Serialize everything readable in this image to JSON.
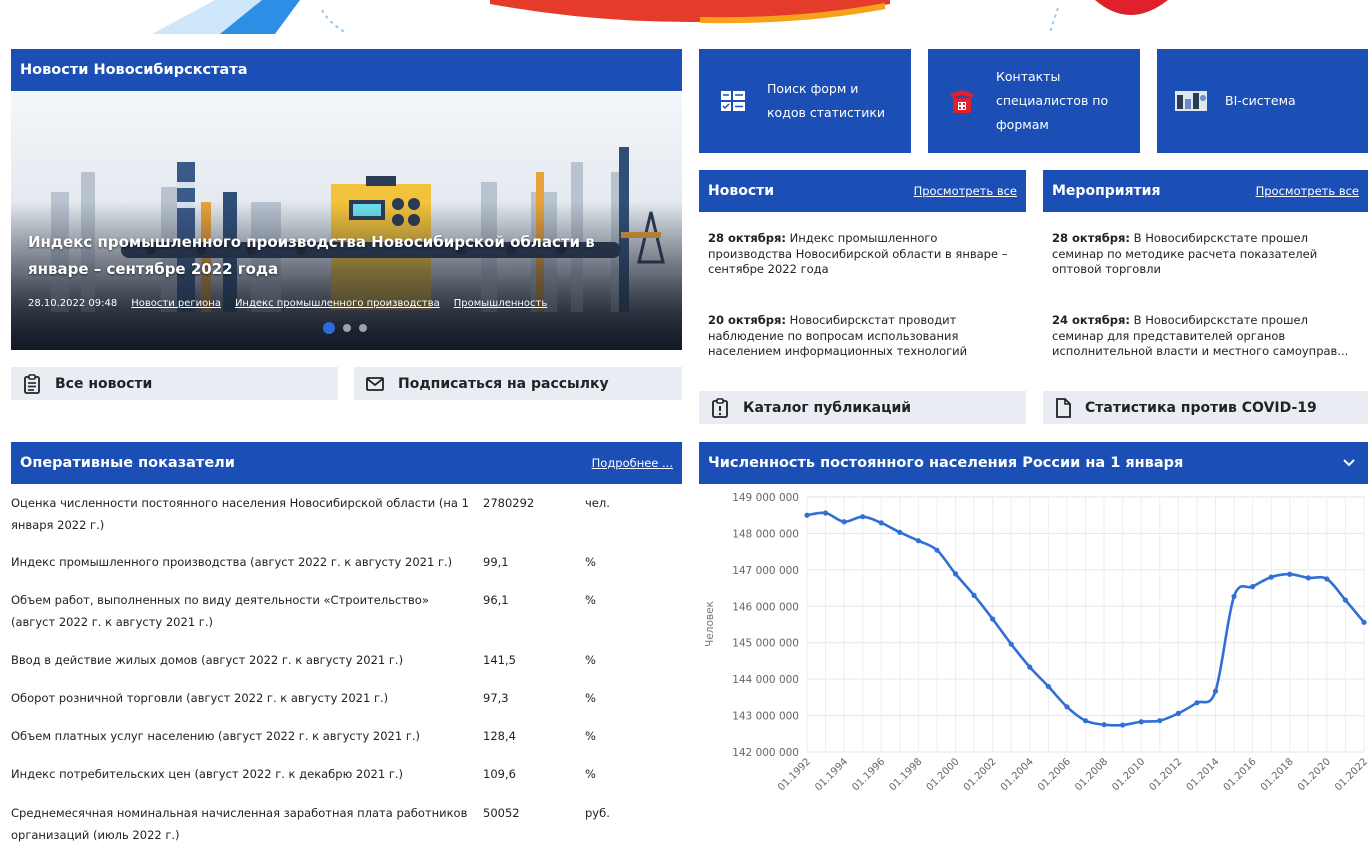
{
  "slider": {
    "title": "Индекс промышленного производства Новосибирской области в январе – сентябре 2022 года",
    "date": "28.10.2022 09:48",
    "tags": [
      "Новости региона",
      "Индекс промышленного производства",
      "Промышленность"
    ]
  },
  "sections": {
    "news_novosibirskstat": "Новости Новосибирскстата",
    "operative": "Оперативные показатели",
    "operative_more": "Подробнее ...",
    "news": "Новости",
    "news_more": "Просмотреть все",
    "events": "Мероприятия",
    "events_more": "Просмотреть все"
  },
  "buttons": {
    "all_news": "Все новости",
    "subscribe": "Подписаться на рассылку",
    "catalog": "Каталог публикаций",
    "covid": "Статистика против COVID-19"
  },
  "tiles": {
    "forms_search": "Поиск форм и кодов статистики",
    "contacts": "Контакты специалистов по формам",
    "bi": "BI-система"
  },
  "news": [
    {
      "date": "28 октября:",
      "text": "Индекс промышленного производства Новосибирской области в январе – сентябре 2022 года"
    },
    {
      "date": "20 октября:",
      "text": "Новосибирскстат проводит наблюдение по вопросам использования населением информационных технологий"
    }
  ],
  "events": [
    {
      "date": "28 октября:",
      "text": "В Новосибирскстате прошел семинар по методике расчета показателей оптовой торговли"
    },
    {
      "date": "24 октября:",
      "text": "В Новосибирскстате прошел семинар для представителей органов исполнительной власти и местного самоуправ..."
    }
  ],
  "indicators": [
    {
      "label": "Оценка численности постоянного населения Новосибирской области (на 1 января 2022 г.)",
      "value": "2780292",
      "unit": "чел."
    },
    {
      "label": "Индекс промышленного производства (август 2022 г. к августу 2021 г.)",
      "value": "99,1",
      "unit": "%"
    },
    {
      "label": "Объем работ, выполненных по виду деятельности «Строительство» (август 2022 г. к августу 2021 г.)",
      "value": "96,1",
      "unit": "%"
    },
    {
      "label": "Ввод в действие жилых домов (август 2022 г. к августу 2021 г.)",
      "value": "141,5",
      "unit": "%"
    },
    {
      "label": "Оборот розничной торговли (август 2022 г. к августу 2021 г.)",
      "value": "97,3",
      "unit": "%"
    },
    {
      "label": "Объем платных услуг населению (август 2022 г. к августу 2021 г.)",
      "value": "128,4",
      "unit": "%"
    },
    {
      "label": "Индекс потребительских цен (август 2022 г. к декабрю 2021 г.)",
      "value": "109,6",
      "unit": "%"
    },
    {
      "label": "Среднемесячная номинальная начисленная заработная плата работников организаций (июль 2022 г.)",
      "value": "50052",
      "unit": "руб."
    }
  ],
  "chart_header": "Численность постоянного населения России на 1 января",
  "chart_data": {
    "type": "line",
    "title": "Численность постоянного населения России на 1 января",
    "ylabel": "Человек",
    "xlabel": "",
    "ylim": [
      142000000,
      149000000
    ],
    "yticks": [
      "149 000 000",
      "148 000 000",
      "147 000 000",
      "146 000 000",
      "145 000 000",
      "144 000 000",
      "143 000 000",
      "142 000 000"
    ],
    "xticks": [
      "01.1992",
      "01.1994",
      "01.1996",
      "01.1998",
      "01.2000",
      "01.2002",
      "01.2004",
      "01.2006",
      "01.2008",
      "01.2010",
      "01.2012",
      "01.2014",
      "01.2016",
      "01.2018",
      "01.2020",
      "01.2022"
    ],
    "x": [
      1992,
      1993,
      1994,
      1995,
      1996,
      1997,
      1998,
      1999,
      2000,
      2001,
      2002,
      2003,
      2004,
      2005,
      2006,
      2007,
      2008,
      2009,
      2010,
      2011,
      2012,
      2013,
      2014,
      2015,
      2016,
      2017,
      2018,
      2019,
      2020,
      2021,
      2022
    ],
    "values": [
      148500000,
      148560000,
      148320000,
      148460000,
      148290000,
      148030000,
      147800000,
      147540000,
      146890000,
      146300000,
      145650000,
      144960000,
      144330000,
      143800000,
      143240000,
      142860000,
      142750000,
      142740000,
      142830000,
      142860000,
      143060000,
      143350000,
      143670000,
      146270000,
      146540000,
      146800000,
      146880000,
      146780000,
      146750000,
      146170000,
      145560000
    ],
    "grid": true,
    "color": "#2f6fd6"
  }
}
